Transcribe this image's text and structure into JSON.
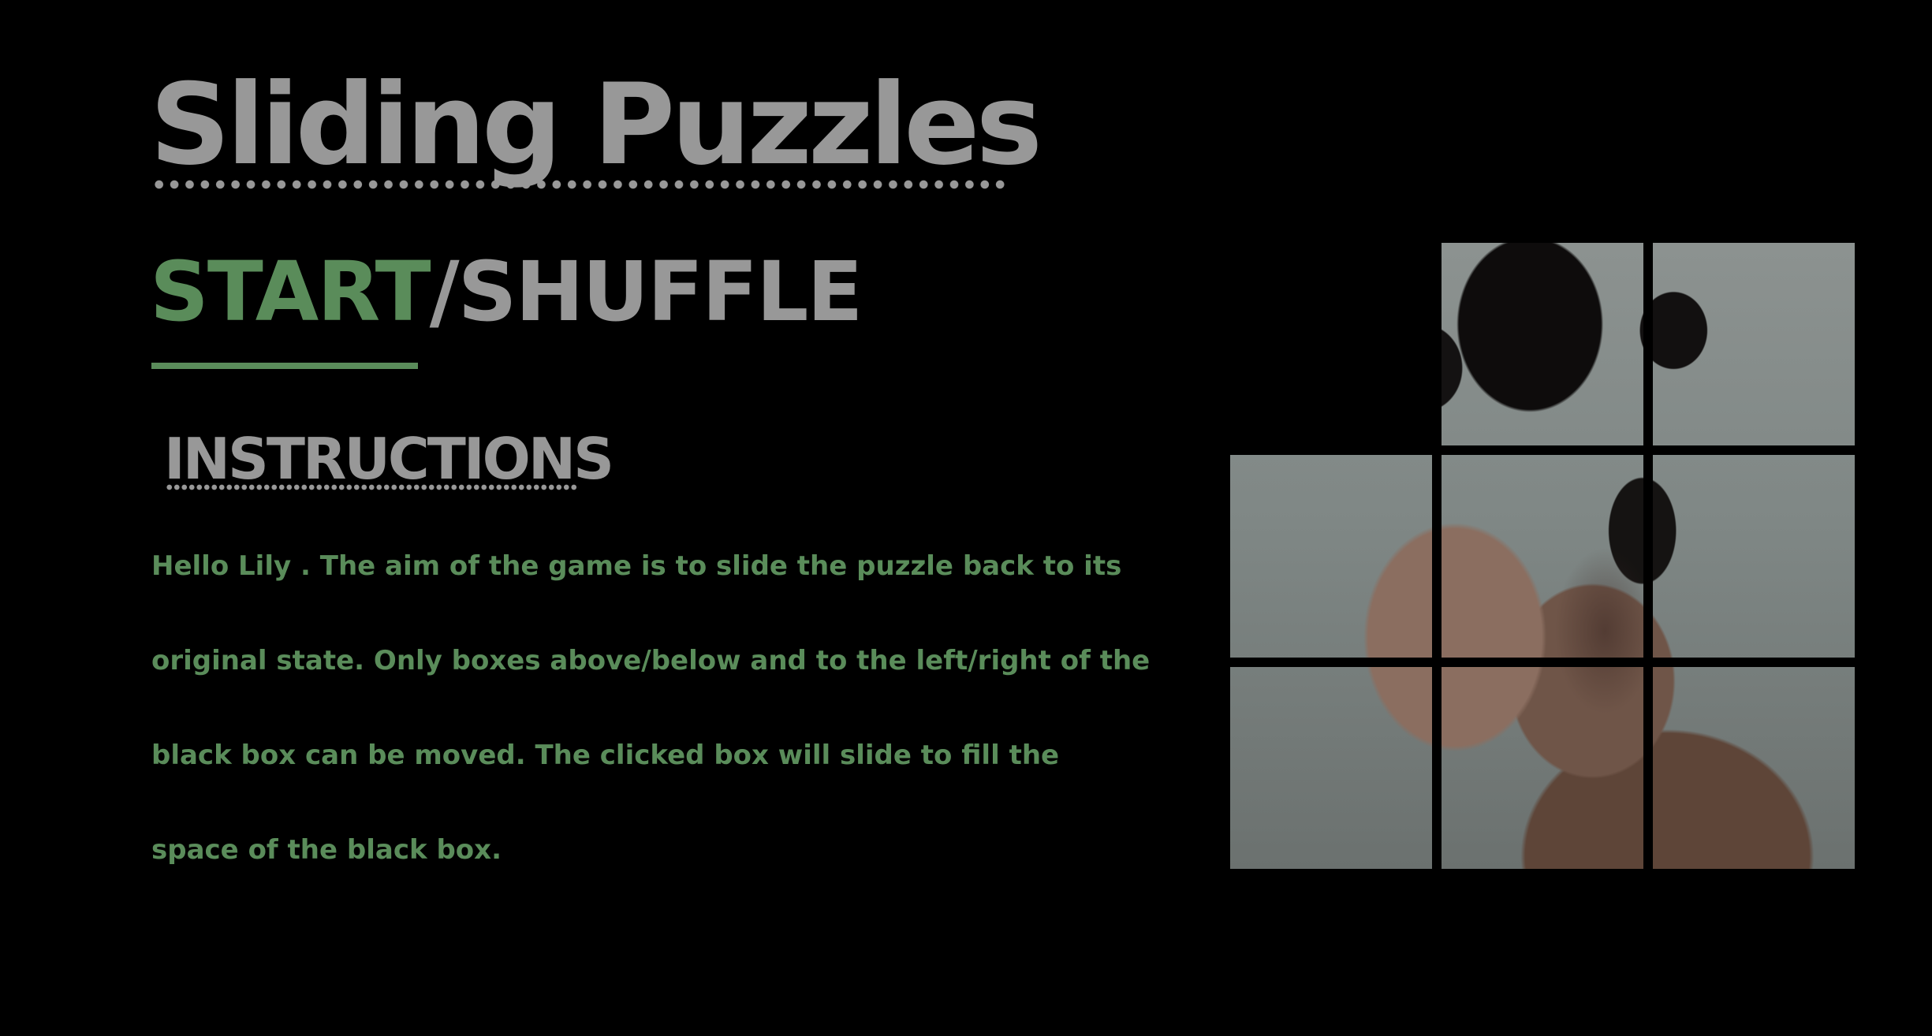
{
  "title": "Sliding Puzzles",
  "controls": {
    "start_label": "START",
    "separator": "/",
    "shuffle_label": "SHUFFLE"
  },
  "instructions": {
    "heading": "INSTRUCTIONS",
    "text": "Hello Lily . The aim of the game is to slide the puzzle back to its original state. Only boxes above/below and to the left/right of the black box can be moved. The clicked box will slide to fill the space of the black box."
  },
  "puzzle": {
    "rows": 3,
    "columns": 3,
    "empty_tile": {
      "row": 1,
      "column": 1
    }
  },
  "colors": {
    "background": "#000000",
    "title": "#989898",
    "accent_green": "#5a8c5a"
  }
}
